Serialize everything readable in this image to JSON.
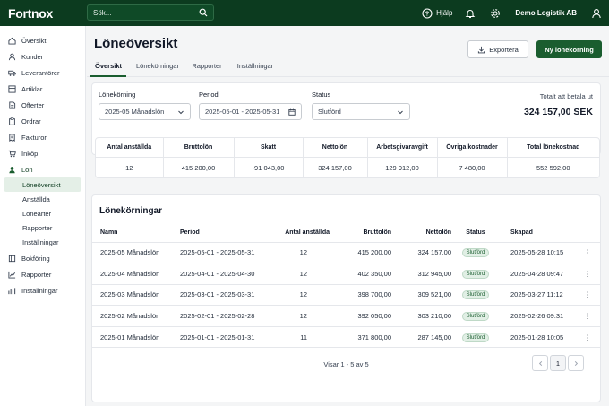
{
  "topbar": {
    "logo": "Fortnox",
    "search_placeholder": "Sök...",
    "help": "Hjälp",
    "company": "Demo Logistik AB"
  },
  "sidebar": {
    "items": [
      {
        "label": "Översikt",
        "icon": "home-icon"
      },
      {
        "label": "Kunder",
        "icon": "users-icon"
      },
      {
        "label": "Leverantörer",
        "icon": "truck-icon"
      },
      {
        "label": "Artiklar",
        "icon": "box-icon"
      },
      {
        "label": "Offerter",
        "icon": "document-icon"
      },
      {
        "label": "Ordrar",
        "icon": "clipboard-icon"
      },
      {
        "label": "Fakturor",
        "icon": "invoice-icon"
      },
      {
        "label": "Inköp",
        "icon": "cart-icon"
      },
      {
        "label": "Lön",
        "icon": "person-icon"
      }
    ],
    "sub_items": [
      {
        "label": "Löneöversikt"
      },
      {
        "label": "Anställda"
      },
      {
        "label": "Lönearter"
      },
      {
        "label": "Rapporter"
      },
      {
        "label": "Inställningar"
      }
    ],
    "bottom_items": [
      {
        "label": "Bokföring",
        "icon": "book-icon"
      },
      {
        "label": "Rapporter",
        "icon": "chart-icon"
      },
      {
        "label": "Inställningar",
        "icon": "gear-icon"
      }
    ]
  },
  "page": {
    "title": "Löneöversikt",
    "export_label": "Exportera",
    "new_label": "Ny lönekörning"
  },
  "tabs": [
    {
      "label": "Översikt"
    },
    {
      "label": "Lönekörningar"
    },
    {
      "label": "Rapporter"
    },
    {
      "label": "Inställningar"
    }
  ],
  "filters": {
    "run_label": "Lönekörning",
    "run_value": "2025-05 Månadslön",
    "period_label": "Period",
    "period_value": "2025-05-01 - 2025-05-31",
    "status_label": "Status",
    "status_value": "Slutförd",
    "total_label": "Totalt att betala ut",
    "total_value": "324 157,00 SEK"
  },
  "summary": {
    "headers": [
      "Antal anställda",
      "Bruttolön",
      "Skatt",
      "Nettolön",
      "Arbetsgivaravgift",
      "Övriga kostnader",
      "Total lönekostnad"
    ],
    "values": [
      "12",
      "415 200,00",
      "-91 043,00",
      "324 157,00",
      "129 912,00",
      "7 480,00",
      "552 592,00"
    ]
  },
  "runs": {
    "title": "Lönekörningar",
    "headers": [
      "Namn",
      "Period",
      "Antal anställda",
      "Bruttolön",
      "Nettolön",
      "Status",
      "Skapad"
    ],
    "rows": [
      {
        "name": "2025-05 Månadslön",
        "period": "2025-05-01 - 2025-05-31",
        "count": "12",
        "gross": "415 200,00",
        "net": "324 157,00",
        "status": "Slutförd",
        "created": "2025-05-28 10:15"
      },
      {
        "name": "2025-04 Månadslön",
        "period": "2025-04-01 - 2025-04-30",
        "count": "12",
        "gross": "402 350,00",
        "net": "312 945,00",
        "status": "Slutförd",
        "created": "2025-04-28 09:47"
      },
      {
        "name": "2025-03 Månadslön",
        "period": "2025-03-01 - 2025-03-31",
        "count": "12",
        "gross": "398 700,00",
        "net": "309 521,00",
        "status": "Slutförd",
        "created": "2025-03-27 11:12"
      },
      {
        "name": "2025-02 Månadslön",
        "period": "2025-02-01 - 2025-02-28",
        "count": "12",
        "gross": "392 050,00",
        "net": "303 210,00",
        "status": "Slutförd",
        "created": "2025-02-26 09:31"
      },
      {
        "name": "2025-01 Månadslön",
        "period": "2025-01-01 - 2025-01-31",
        "count": "11",
        "gross": "371 800,00",
        "net": "287 145,00",
        "status": "Slutförd",
        "created": "2025-01-28 10:05"
      }
    ],
    "pager_text": "Visar 1 - 5 av 5",
    "current_page": "1"
  }
}
